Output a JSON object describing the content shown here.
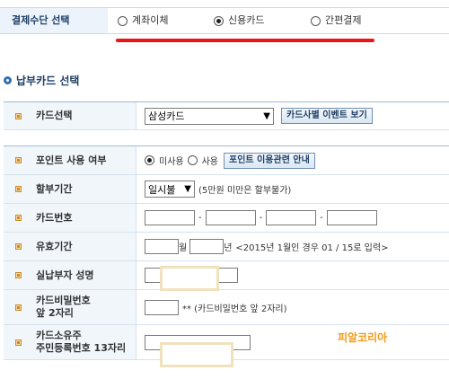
{
  "payment_method": {
    "label": "결제수단 선택",
    "options": [
      {
        "label": "계좌이체",
        "selected": false
      },
      {
        "label": "신용카드",
        "selected": true
      },
      {
        "label": "간편결제",
        "selected": false
      }
    ]
  },
  "section_title": "납부카드 선택",
  "card_select": {
    "label": "카드선택",
    "value": "삼성카드",
    "event_button": "카드사별 이벤트 보기"
  },
  "points": {
    "label": "포인트 사용 여부",
    "options": [
      {
        "label": "미사용",
        "selected": true
      },
      {
        "label": "사용",
        "selected": false
      }
    ],
    "guide_button": "포인트 이용관련 안내"
  },
  "installment": {
    "label": "할부기간",
    "value": "일시불",
    "note": "(5만원 미만은 할부불가)"
  },
  "card_number": {
    "label": "카드번호",
    "separator": "-"
  },
  "expiry": {
    "label": "유효기간",
    "month_unit": "월",
    "year_unit": "년",
    "note": "<2015년 1월인 경우 01 / 15로 입력>"
  },
  "payer_name": {
    "label": "실납부자 성명"
  },
  "card_password": {
    "label_line1": "카드비밀번호",
    "label_line2": "앞 2자리",
    "note": "** (카드비밀번호 앞 2자리)"
  },
  "card_owner_id": {
    "label_line1": "카드소유주",
    "label_line2": "주민등록번호 13자리"
  },
  "watermark": "피알코리아",
  "colors": {
    "accent_red": "#e8151c",
    "header_blue": "#1f3f66",
    "watermark_orange": "#f39a1a"
  }
}
